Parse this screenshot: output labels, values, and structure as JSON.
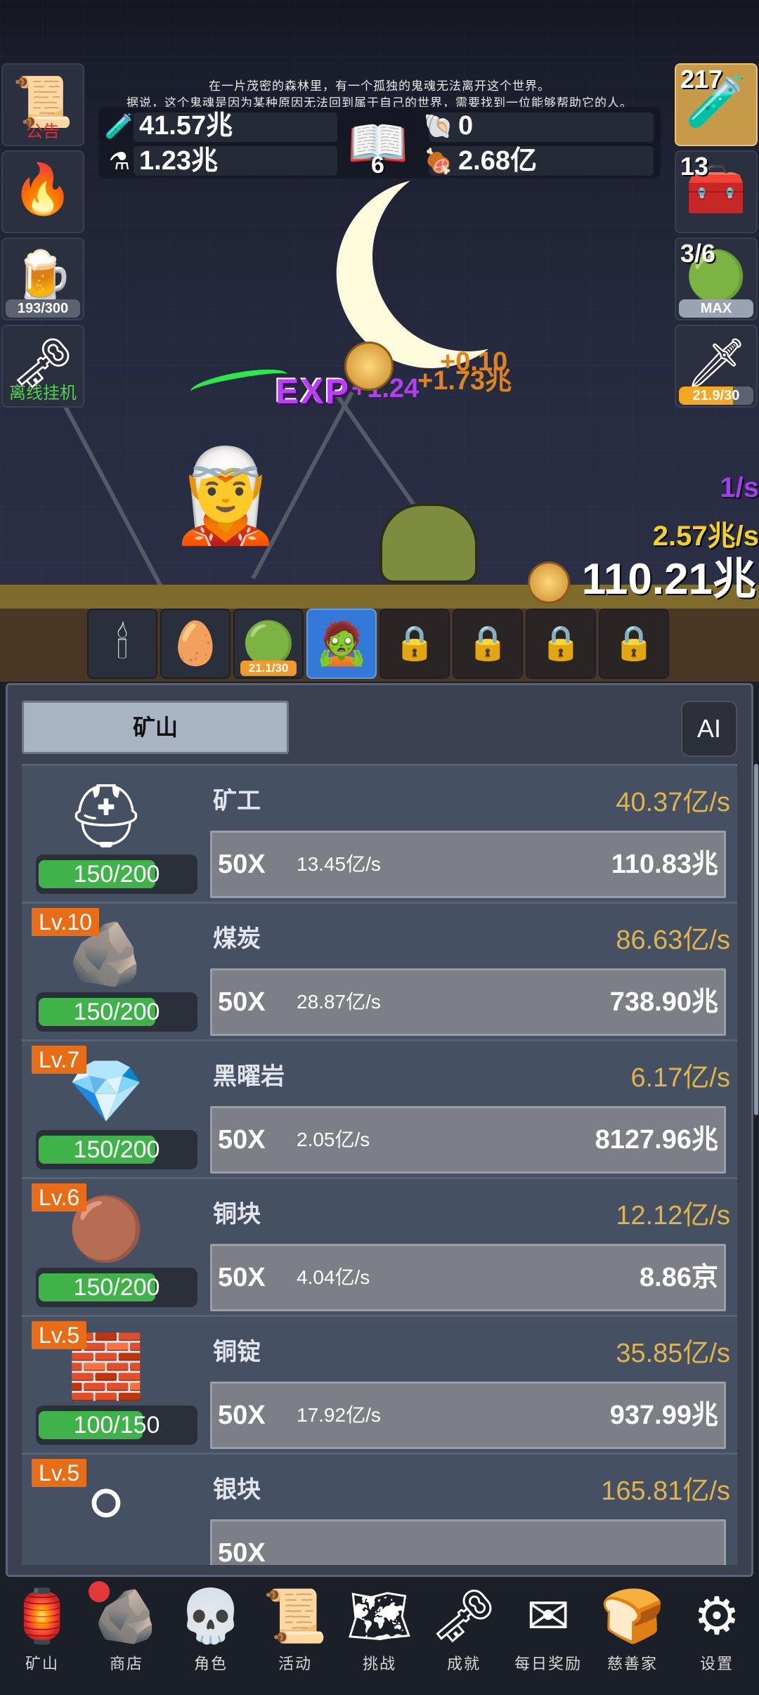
{
  "story": {
    "line1": "在一片茂密的森林里，有一个孤独的鬼魂无法离开这个世界。",
    "line2": "据说，这个鬼魂是因为某种原因无法回到属于自己的世界，需要找到一位能够帮助它的人。"
  },
  "left_buttons": [
    {
      "icon": "scroll-icon",
      "glyph": "📜",
      "label": "公告",
      "label_color": "#e03131"
    },
    {
      "icon": "torch-icon",
      "glyph": "🔥",
      "label": ""
    },
    {
      "icon": "beer-mug-icon",
      "glyph": "🍺",
      "progress": "193/300",
      "progress_fraction": 0.64
    },
    {
      "icon": "key-icon",
      "glyph": "🗝",
      "label": "离线挂机",
      "label_color": "#4fd14a"
    }
  ],
  "resources": {
    "blue_potion": "41.57兆",
    "yellow_potion": "1.23兆",
    "book_count": "6",
    "shell": "0",
    "meat": "2.68亿"
  },
  "right_buttons": [
    {
      "icon": "red-potion-icon",
      "glyph": "🧪",
      "count": "217"
    },
    {
      "icon": "treasure-chest-icon",
      "glyph": "🧰",
      "count": "13"
    },
    {
      "icon": "slime-icon",
      "glyph": "🟢",
      "count": "3/6",
      "bar": "MAX",
      "progress_fraction": 1.0
    },
    {
      "icon": "sword-icon",
      "glyph": "🗡",
      "bar": "21.9/30",
      "progress_fraction": 0.73
    }
  ],
  "floating": {
    "exp_label": "EXP",
    "exp_value": "+1.24",
    "gain_1": "+0.10",
    "gain_2": "+1.73兆"
  },
  "rates": {
    "exp_rate": "1/s",
    "gold_rate": "2.57兆/s",
    "gold_total": "110.21兆"
  },
  "slots": [
    {
      "icon": "candle-icon",
      "glyph": "🕯",
      "state": "normal"
    },
    {
      "icon": "egg-icon",
      "glyph": "🥚",
      "state": "normal"
    },
    {
      "icon": "slime-pet-icon",
      "glyph": "🟢",
      "state": "normal",
      "badge": "21.1/30"
    },
    {
      "icon": "zombie-pet-icon",
      "glyph": "🧟",
      "state": "active"
    },
    {
      "icon": "lock-icon",
      "glyph": "🔒",
      "state": "locked"
    },
    {
      "icon": "lock-icon",
      "glyph": "🔒",
      "state": "locked"
    },
    {
      "icon": "lock-icon",
      "glyph": "🔒",
      "state": "locked"
    },
    {
      "icon": "lock-icon",
      "glyph": "🔒",
      "state": "locked"
    }
  ],
  "panel": {
    "tab_label": "矿山",
    "ai_label": "AI"
  },
  "mines": [
    {
      "icon": "miner-helmet-icon",
      "glyph": "⛑",
      "level": "",
      "name": "矿工",
      "rate": "40.37亿/s",
      "capacity": "150/200",
      "capacity_fraction": 0.75,
      "mult": "50X",
      "increment": "13.45亿/s",
      "cost": "110.83兆"
    },
    {
      "icon": "coal-icon",
      "glyph": "🪨",
      "level": "Lv.10",
      "name": "煤炭",
      "rate": "86.63亿/s",
      "capacity": "150/200",
      "capacity_fraction": 0.75,
      "mult": "50X",
      "increment": "28.87亿/s",
      "cost": "738.90兆"
    },
    {
      "icon": "obsidian-icon",
      "glyph": "💎",
      "level": "Lv.7",
      "name": "黑曜岩",
      "rate": "6.17亿/s",
      "capacity": "150/200",
      "capacity_fraction": 0.75,
      "mult": "50X",
      "increment": "2.05亿/s",
      "cost": "8127.96兆"
    },
    {
      "icon": "copper-ore-icon",
      "glyph": "🟤",
      "level": "Lv.6",
      "name": "铜块",
      "rate": "12.12亿/s",
      "capacity": "150/200",
      "capacity_fraction": 0.75,
      "mult": "50X",
      "increment": "4.04亿/s",
      "cost": "8.86京"
    },
    {
      "icon": "copper-ingot-icon",
      "glyph": "🧱",
      "level": "Lv.5",
      "name": "铜锭",
      "rate": "35.85亿/s",
      "capacity": "100/150",
      "capacity_fraction": 0.67,
      "mult": "50X",
      "increment": "17.92亿/s",
      "cost": "937.99兆"
    },
    {
      "icon": "silver-ore-icon",
      "glyph": "⚪",
      "level": "Lv.5",
      "name": "银块",
      "rate": "165.81亿/s",
      "capacity": "",
      "capacity_fraction": 0,
      "mult": "50X",
      "increment": "",
      "cost": ""
    }
  ],
  "nav": [
    {
      "icon": "lantern-icon",
      "glyph": "🏮",
      "label": "矿山"
    },
    {
      "icon": "shop-stone-icon",
      "glyph": "🪨",
      "label": "商店",
      "dot": true
    },
    {
      "icon": "skull-icon",
      "glyph": "💀",
      "label": "角色"
    },
    {
      "icon": "scroll-icon",
      "glyph": "📜",
      "label": "活动"
    },
    {
      "icon": "map-icon",
      "glyph": "🗺",
      "label": "挑战"
    },
    {
      "icon": "key-icon",
      "glyph": "🗝",
      "label": "成就"
    },
    {
      "icon": "envelope-icon",
      "glyph": "✉",
      "label": "每日奖励"
    },
    {
      "icon": "bread-icon",
      "glyph": "🍞",
      "label": "慈善家"
    },
    {
      "icon": "gear-icon",
      "glyph": "⚙",
      "label": "设置"
    }
  ]
}
